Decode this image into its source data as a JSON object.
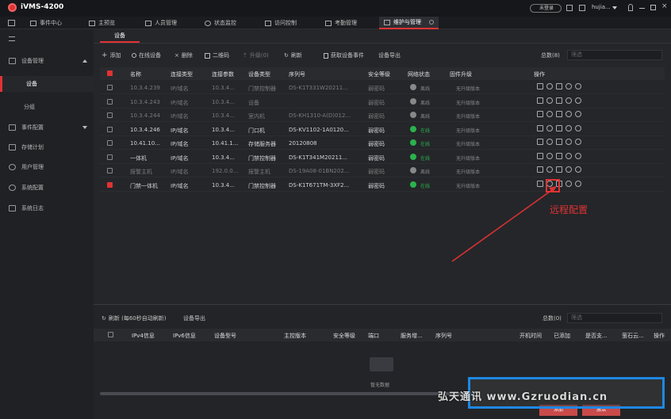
{
  "app": {
    "title": "iVMS-4200",
    "user": "未登录",
    "user2": "hujia..."
  },
  "tabs": [
    {
      "label": "事件中心"
    },
    {
      "label": "主预览"
    },
    {
      "label": "人员管理"
    },
    {
      "label": "状态监控"
    },
    {
      "label": "访问控制"
    },
    {
      "label": "考勤管理"
    },
    {
      "label": "维护与管理"
    }
  ],
  "sidebar": {
    "group": "设备管理",
    "items": [
      "设备",
      "分组",
      "事件配置",
      "存储计划",
      "用户管理",
      "系统配置",
      "系统日志"
    ]
  },
  "device_tab": "设备",
  "toolbar": {
    "add": "添加",
    "online": "在线设备",
    "delete": "删除",
    "qrcode": "二维码",
    "upgrade": "升级(0)",
    "refresh": "刷新",
    "get_events": "获取设备事件",
    "export": "设备导出",
    "total": "总数(8)",
    "filter_placeholder": "筛选"
  },
  "columns": [
    "名称",
    "连接类型",
    "连接参数",
    "设备类型",
    "序列号",
    "安全等级",
    "网络状态",
    "固件升级",
    "操作"
  ],
  "rows": [
    {
      "name": "10.3.4.239",
      "conn": "IP/域名",
      "param": "10.3.4...",
      "type": "门禁控制器",
      "serial": "DS-K1T331W20211...",
      "sec": "弱密码",
      "net": "离线",
      "fw": "无升级版本",
      "online": false,
      "dim": true,
      "checked": false
    },
    {
      "name": "10.3.4.243",
      "conn": "IP/域名",
      "param": "10.3.4...",
      "type": "设备",
      "serial": "",
      "sec": "弱密码",
      "net": "离线",
      "fw": "无升级版本",
      "online": false,
      "dim": true,
      "checked": false
    },
    {
      "name": "10.3.4.244",
      "conn": "IP/域名",
      "param": "10.3.4...",
      "type": "室内机",
      "serial": "DS-KH1310-A(D)012...",
      "sec": "弱密码",
      "net": "离线",
      "fw": "无升级版本",
      "online": false,
      "dim": true,
      "checked": false
    },
    {
      "name": "10.3.4.246",
      "conn": "IP/域名",
      "param": "10.3.4...",
      "type": "门口机",
      "serial": "DS-KV1102-1A0120...",
      "sec": "弱密码",
      "net": "在线",
      "fw": "无升级版本",
      "online": true,
      "dim": false,
      "checked": false
    },
    {
      "name": "10.41.10...",
      "conn": "IP/域名",
      "param": "10.41.1...",
      "type": "存储服务器",
      "serial": "20120808",
      "sec": "弱密码",
      "net": "在线",
      "fw": "无升级版本",
      "online": true,
      "dim": false,
      "checked": false
    },
    {
      "name": "一体机",
      "conn": "IP/域名",
      "param": "10.3.4...",
      "type": "门禁控制器",
      "serial": "DS-K1T341M20211...",
      "sec": "弱密码",
      "net": "在线",
      "fw": "无升级版本",
      "online": true,
      "dim": false,
      "checked": false
    },
    {
      "name": "报警主机",
      "conn": "IP/域名",
      "param": "192.0.0...",
      "type": "报警主机",
      "serial": "DS-19A08-01BN202...",
      "sec": "弱密码",
      "net": "离线",
      "fw": "无升级版本",
      "online": false,
      "dim": true,
      "checked": false
    },
    {
      "name": "门禁一体机",
      "conn": "IP/域名",
      "param": "10.3.4...",
      "type": "门禁控制器",
      "serial": "DS-K1T671TM-3XF2...",
      "sec": "弱密码",
      "net": "在线",
      "fw": "无升级版本",
      "online": true,
      "dim": false,
      "checked": true
    }
  ],
  "annotation": {
    "label": "远程配置",
    "color": "#e03333"
  },
  "bottom": {
    "refresh": "刷新 (每60秒自动刷新)",
    "export": "设备导出",
    "total": "总数(0)",
    "filter_placeholder": "筛选",
    "columns": [
      "IPv4信息",
      "IPv6信息",
      "设备型号",
      "主控版本",
      "安全等级",
      "端口",
      "服务增...",
      "序列号",
      "开机时间",
      "已添加",
      "是否支...",
      "萤石云...",
      "操作"
    ],
    "empty": "暂无数据"
  },
  "watermark": "弘天通讯 www.Gzruodian.cn",
  "footer_buttons": [
    "添加",
    "激活"
  ]
}
